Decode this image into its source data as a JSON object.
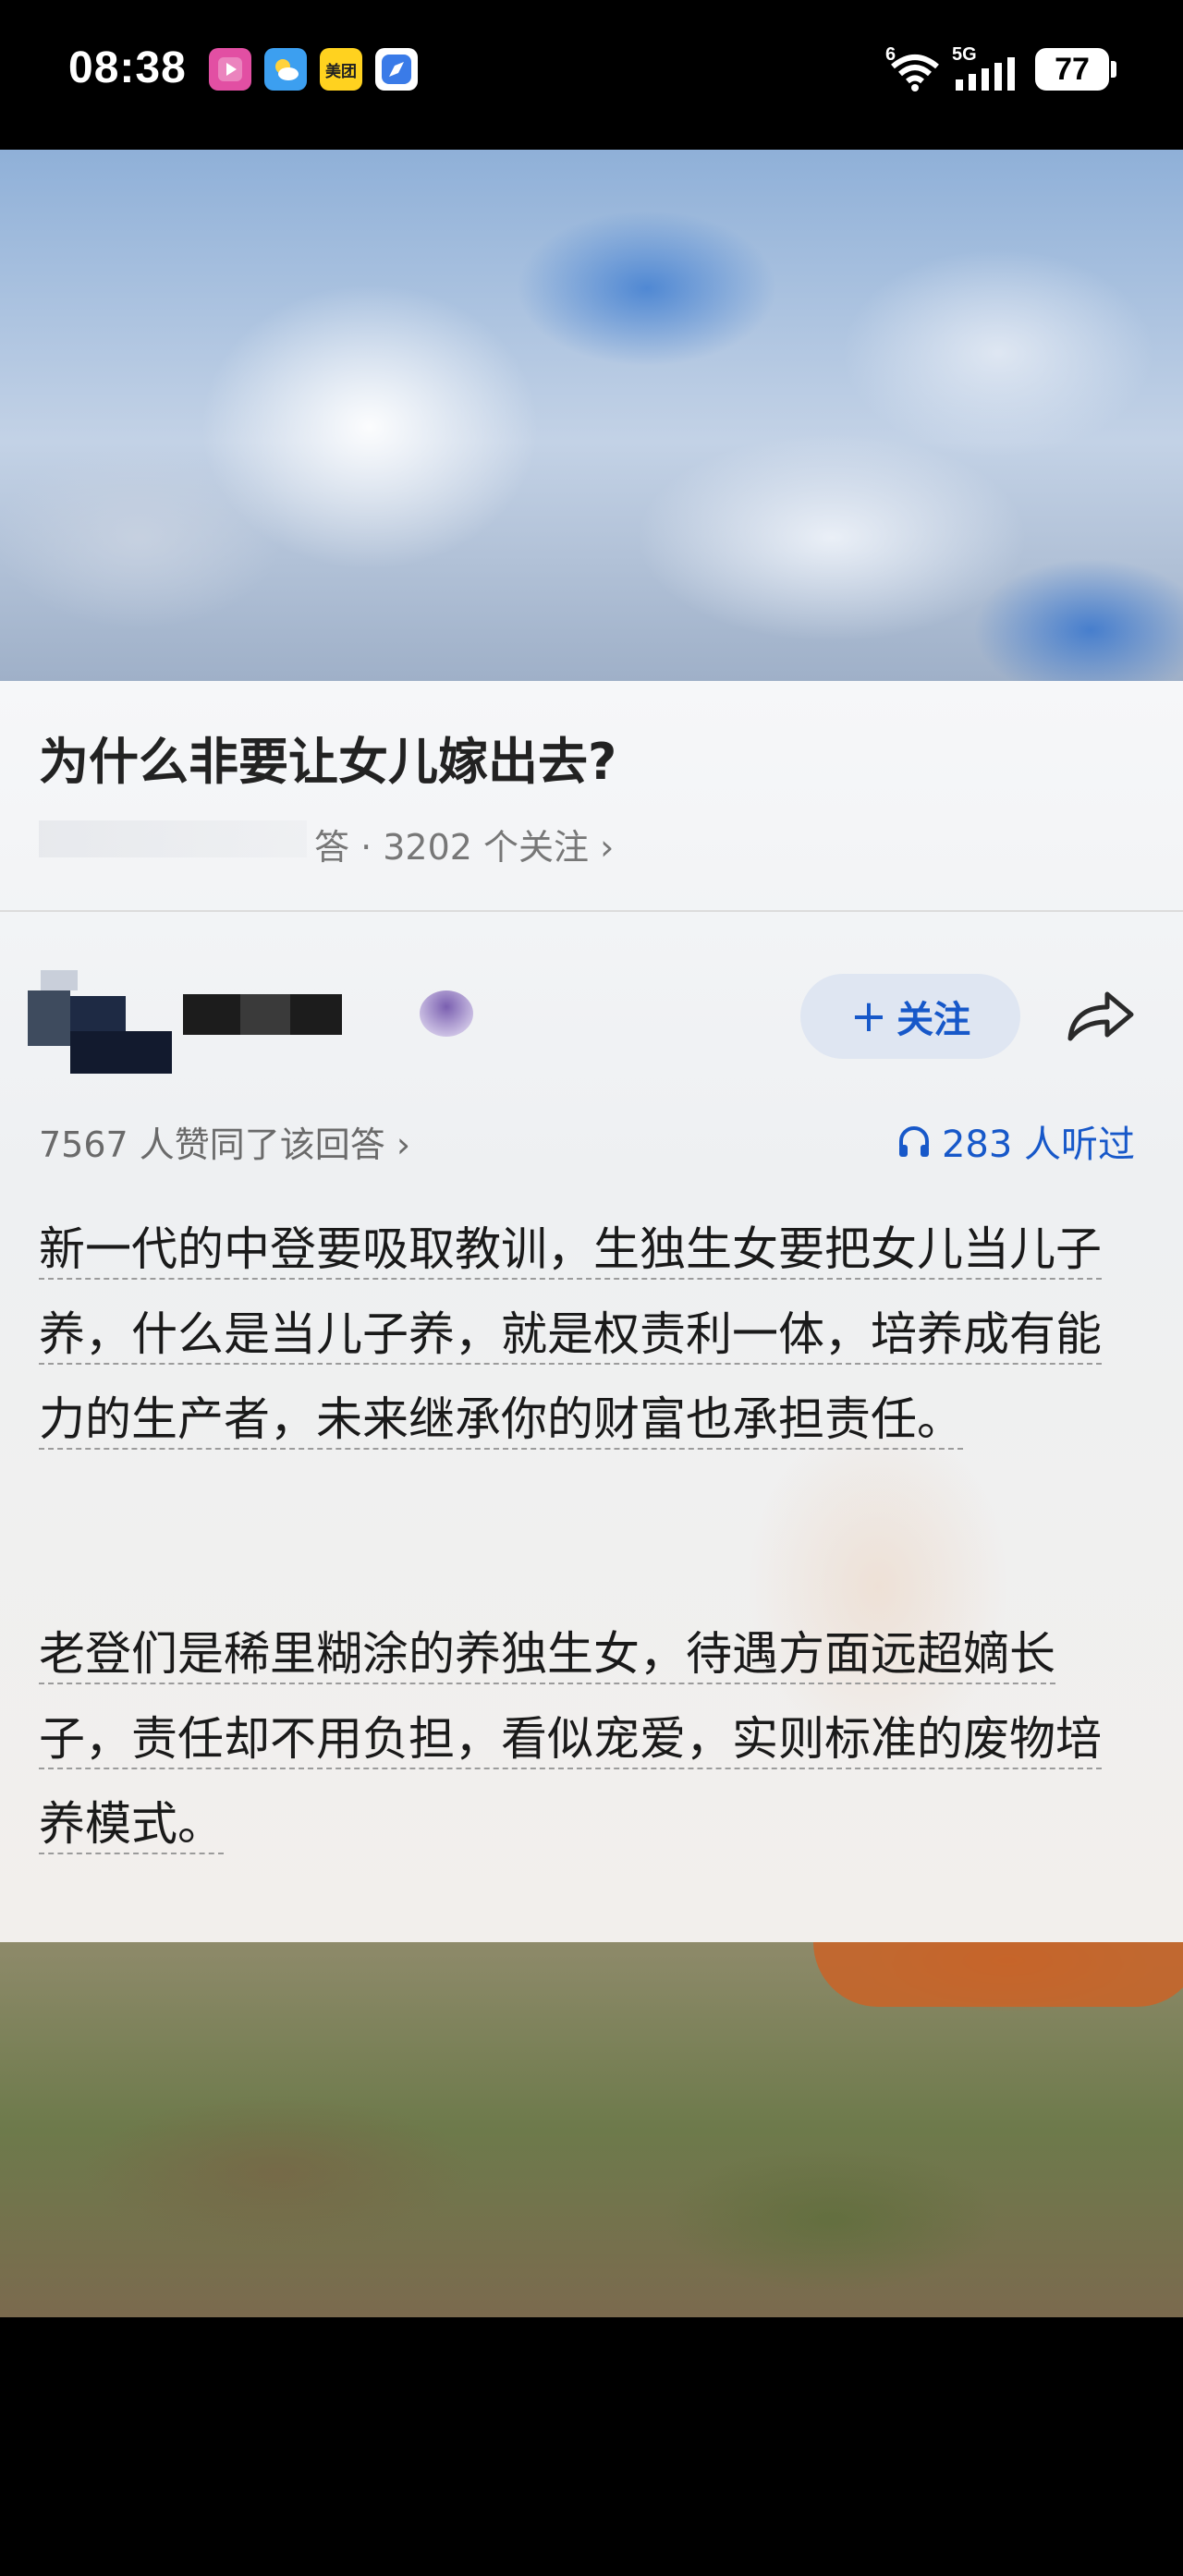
{
  "status_bar": {
    "time": "08:38",
    "apps": [
      {
        "icon": "video-app-icon",
        "color": "#e04fa0"
      },
      {
        "icon": "weather-app-icon",
        "color": "#4aa6f0"
      },
      {
        "icon": "meituan-app-icon",
        "color": "#ffd21f",
        "label": "美团"
      },
      {
        "icon": "browser-app-icon",
        "color": "#3a7be8"
      }
    ],
    "network": "5G",
    "wifi_badge": "6",
    "battery": "77"
  },
  "question": {
    "title": "为什么非要让女儿嫁出去?",
    "meta": "答 · 3202 个关注 ›"
  },
  "answer_header": {
    "follow_label": "关注",
    "agree_text": "7567 人赞同了该回答 ›",
    "listen_text": "283 人听过",
    "accent_color": "#1758c9"
  },
  "answer_body": {
    "paragraph1": "新一代的中登要吸取教训，生独生女要把女儿当儿子养，什么是当儿子养，就是权责利一体，培养成有能力的生产者，未来继承你的财富也承担责任。",
    "paragraph2": "老登们是稀里糊涂的养独生女，待遇方面远超嫡长子，责任却不用负担，看似宠爱，实则标准的废物培养模式。"
  }
}
